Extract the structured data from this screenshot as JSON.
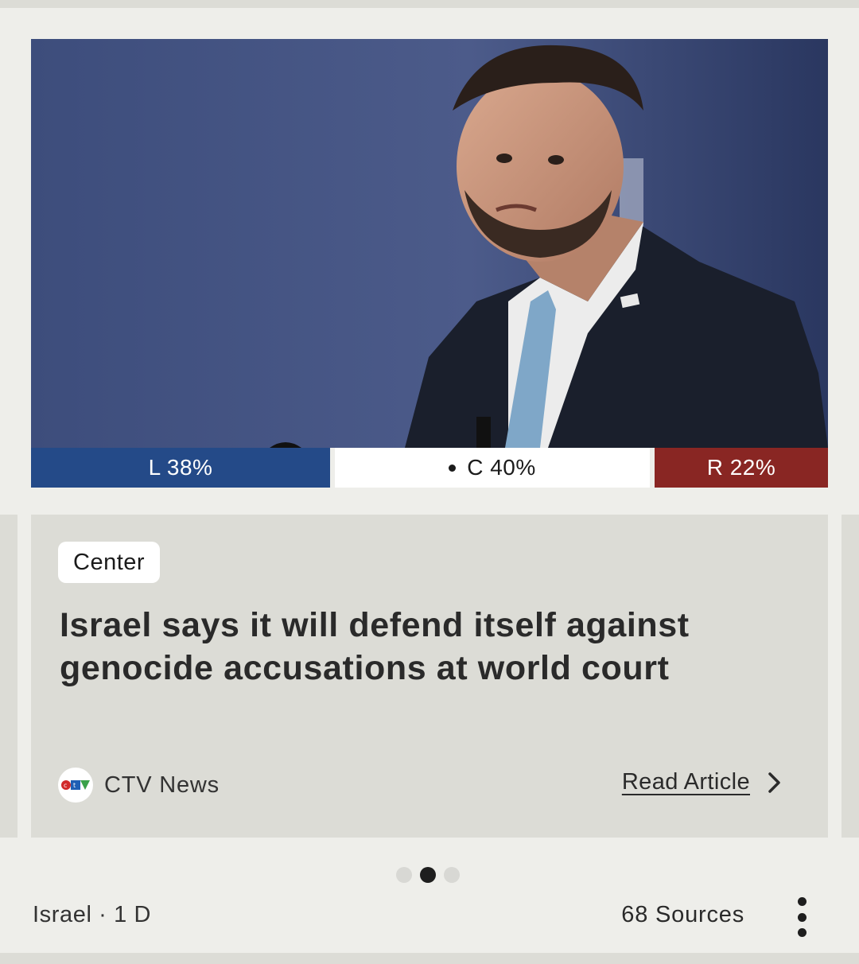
{
  "bias": {
    "left_label": "L 38%",
    "center_label": "C 40%",
    "right_label": "R 22%",
    "left_pct": 38,
    "center_pct": 40,
    "right_pct": 22,
    "colors": {
      "left": "#244a88",
      "center": "#ffffff",
      "right": "#892623"
    }
  },
  "article": {
    "badge": "Center",
    "headline": "Israel says it will defend itself against genocide accusations at world court",
    "source_name": "CTV News",
    "source_logo": "CTV",
    "read_label": "Read Article"
  },
  "pagination": {
    "count": 3,
    "active_index": 1
  },
  "footer": {
    "topic_time": "Israel · 1 D",
    "sources": "68 Sources"
  },
  "icons": [
    "chevron-right-icon",
    "more-vertical-icon",
    "ctv-logo-icon"
  ]
}
